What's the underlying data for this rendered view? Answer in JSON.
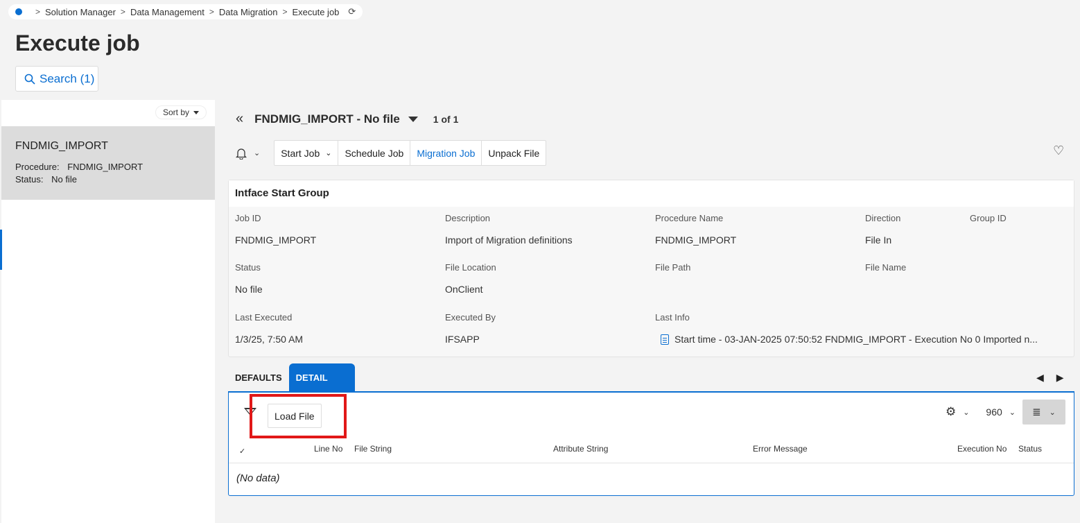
{
  "breadcrumb": {
    "items": [
      "Solution Manager",
      "Data Management",
      "Data Migration",
      "Execute job"
    ],
    "home_icon": "dot-icon",
    "refresh_icon": "refresh-icon"
  },
  "page": {
    "title": "Execute job",
    "search_label": "Search (1)"
  },
  "left_panel": {
    "sort_label": "Sort by",
    "record": {
      "title": "FNDMIG_IMPORT",
      "procedure_label": "Procedure:",
      "procedure_value": "FNDMIG_IMPORT",
      "status_label": "Status:",
      "status_value": "No file"
    }
  },
  "record_header": {
    "title": "FNDMIG_IMPORT - No file",
    "count": "1 of 1"
  },
  "toolbar": {
    "start_job": "Start Job",
    "schedule_job": "Schedule Job",
    "migration_job": "Migration Job",
    "unpack_file": "Unpack File"
  },
  "info_card": {
    "title": "Intface Start Group",
    "fields": {
      "job_id": {
        "label": "Job ID",
        "value": "FNDMIG_IMPORT"
      },
      "description": {
        "label": "Description",
        "value": "Import of Migration definitions"
      },
      "procedure_name": {
        "label": "Procedure Name",
        "value": "FNDMIG_IMPORT"
      },
      "direction": {
        "label": "Direction",
        "value": "File In"
      },
      "group_id": {
        "label": "Group ID",
        "value": ""
      },
      "status": {
        "label": "Status",
        "value": "No file"
      },
      "file_location": {
        "label": "File Location",
        "value": "OnClient"
      },
      "file_path": {
        "label": "File Path",
        "value": ""
      },
      "file_name": {
        "label": "File Name",
        "value": ""
      },
      "last_executed": {
        "label": "Last Executed",
        "value": "1/3/25, 7:50 AM"
      },
      "executed_by": {
        "label": "Executed By",
        "value": "IFSAPP"
      },
      "last_info": {
        "label": "Last Info",
        "value": "Start time - 03-JAN-2025 07:50:52  FNDMIG_IMPORT - Execution No 0 Imported n..."
      }
    }
  },
  "tabs": [
    {
      "label": "DEFAULTS",
      "active": false
    },
    {
      "label": "DETAIL",
      "active": true
    }
  ],
  "detail": {
    "load_file": "Load File",
    "page_size": "960",
    "columns": [
      "Line No",
      "File String",
      "Attribute String",
      "Error Message",
      "Execution No",
      "Status"
    ],
    "empty_text": "(No data)"
  },
  "colors": {
    "accent": "#0a6ed1",
    "highlight": "#e11818"
  }
}
